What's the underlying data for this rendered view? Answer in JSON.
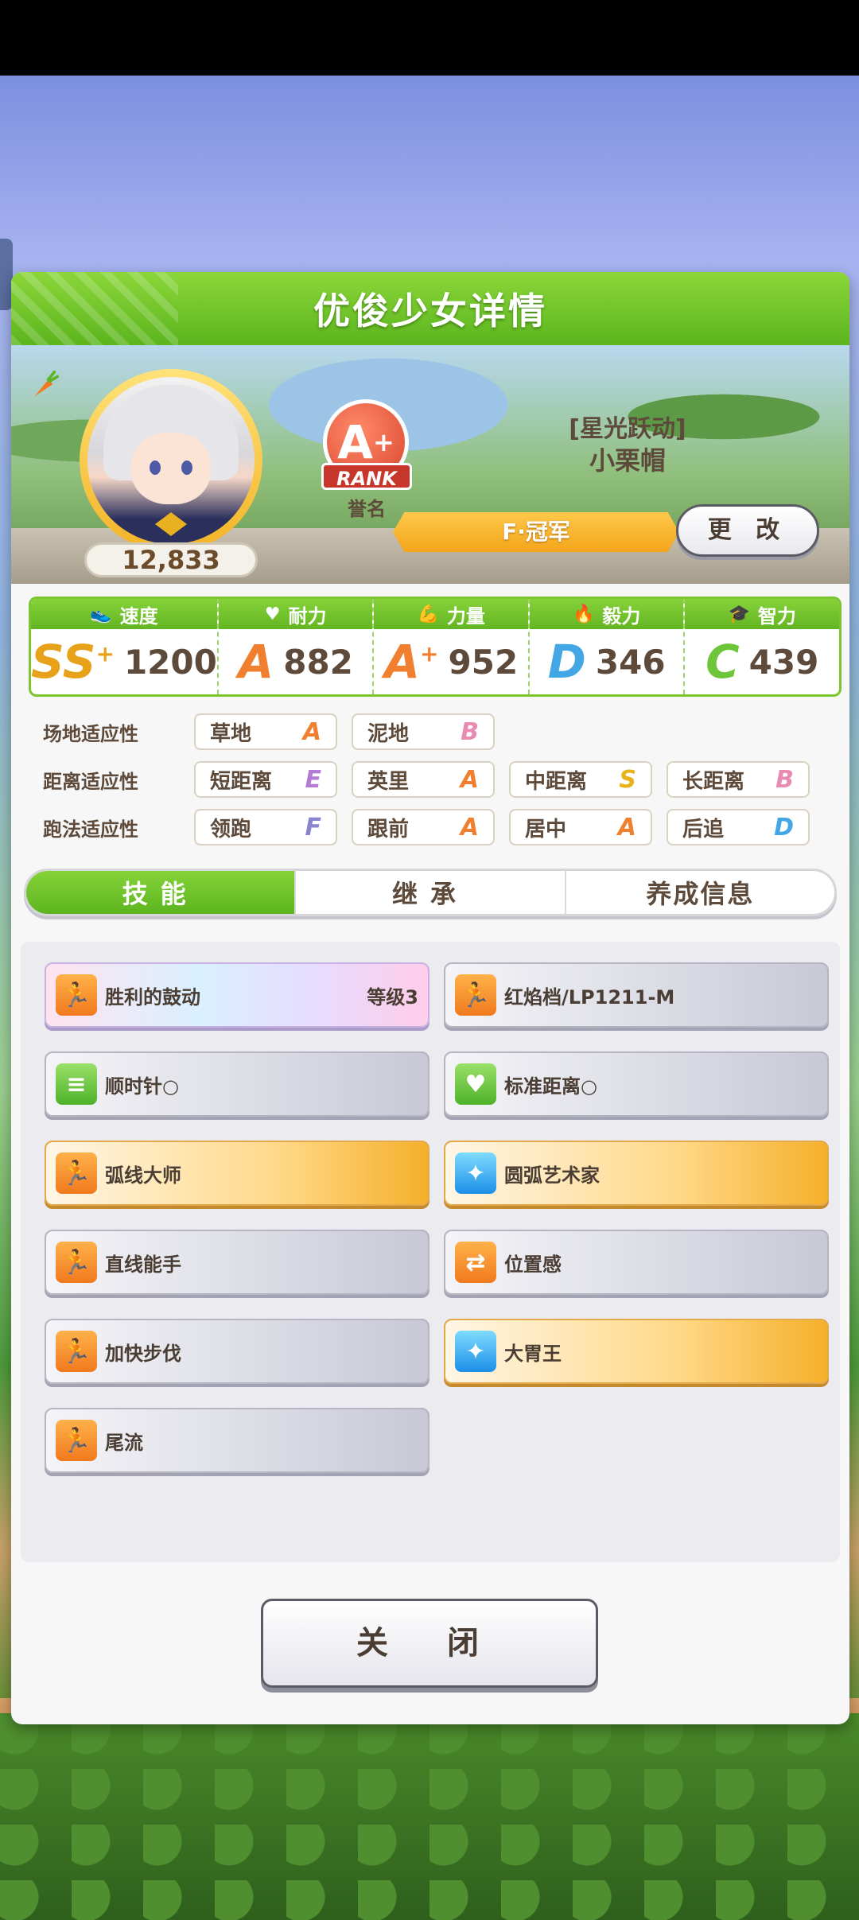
{
  "dialog": {
    "title": "优俊少女详情"
  },
  "profile": {
    "fans": "12,833",
    "rank_grade": "A",
    "rank_plus": "+",
    "rank_label": "RANK",
    "honor_label": "誉名",
    "epithet": "[星光跃动]",
    "name": "小栗帽",
    "title": "F·冠军",
    "change_label": "更 改"
  },
  "stats": [
    {
      "label": "速度",
      "icon": "shoe-icon",
      "grade": "SS",
      "plus": "+",
      "value": "1200"
    },
    {
      "label": "耐力",
      "icon": "heart-icon",
      "grade": "A",
      "plus": "",
      "value": "882"
    },
    {
      "label": "力量",
      "icon": "muscle-icon",
      "grade": "A",
      "plus": "+",
      "value": "952"
    },
    {
      "label": "毅力",
      "icon": "flame-icon",
      "grade": "D",
      "plus": "",
      "value": "346"
    },
    {
      "label": "智力",
      "icon": "graduation-cap-icon",
      "grade": "C",
      "plus": "",
      "value": "439"
    }
  ],
  "aptitudes": {
    "track": {
      "label": "场地适应性",
      "items": [
        {
          "name": "草地",
          "grade": "A"
        },
        {
          "name": "泥地",
          "grade": "B"
        }
      ]
    },
    "distance": {
      "label": "距离适应性",
      "items": [
        {
          "name": "短距离",
          "grade": "E"
        },
        {
          "name": "英里",
          "grade": "A"
        },
        {
          "name": "中距离",
          "grade": "S"
        },
        {
          "name": "长距离",
          "grade": "B"
        }
      ]
    },
    "style": {
      "label": "跑法适应性",
      "items": [
        {
          "name": "领跑",
          "grade": "F"
        },
        {
          "name": "跟前",
          "grade": "A"
        },
        {
          "name": "居中",
          "grade": "A"
        },
        {
          "name": "后追",
          "grade": "D"
        }
      ]
    }
  },
  "tabs": [
    {
      "label": "技能",
      "active": true
    },
    {
      "label": "继承",
      "active": false
    },
    {
      "label": "养成信息",
      "active": false
    }
  ],
  "skills": [
    {
      "name": "胜利的鼓动",
      "level": "等级3",
      "style": "rainbow",
      "icon": "orange"
    },
    {
      "name": "红焰档/LP1211-M",
      "level": "",
      "style": "normal",
      "icon": "orange"
    },
    {
      "name": "顺时针○",
      "level": "",
      "style": "normal",
      "icon": "green"
    },
    {
      "name": "标准距离○",
      "level": "",
      "style": "normal",
      "icon": "green"
    },
    {
      "name": "弧线大师",
      "level": "",
      "style": "gold",
      "icon": "orange"
    },
    {
      "name": "圆弧艺术家",
      "level": "",
      "style": "gold",
      "icon": "blue"
    },
    {
      "name": "直线能手",
      "level": "",
      "style": "normal",
      "icon": "orange"
    },
    {
      "name": "位置感",
      "level": "",
      "style": "normal",
      "icon": "orange"
    },
    {
      "name": "加快步伐",
      "level": "",
      "style": "normal",
      "icon": "orange"
    },
    {
      "name": "大胃王",
      "level": "",
      "style": "gold",
      "icon": "blue"
    },
    {
      "name": "尾流",
      "level": "",
      "style": "normal",
      "icon": "orange"
    }
  ],
  "close_label": "关 闭"
}
